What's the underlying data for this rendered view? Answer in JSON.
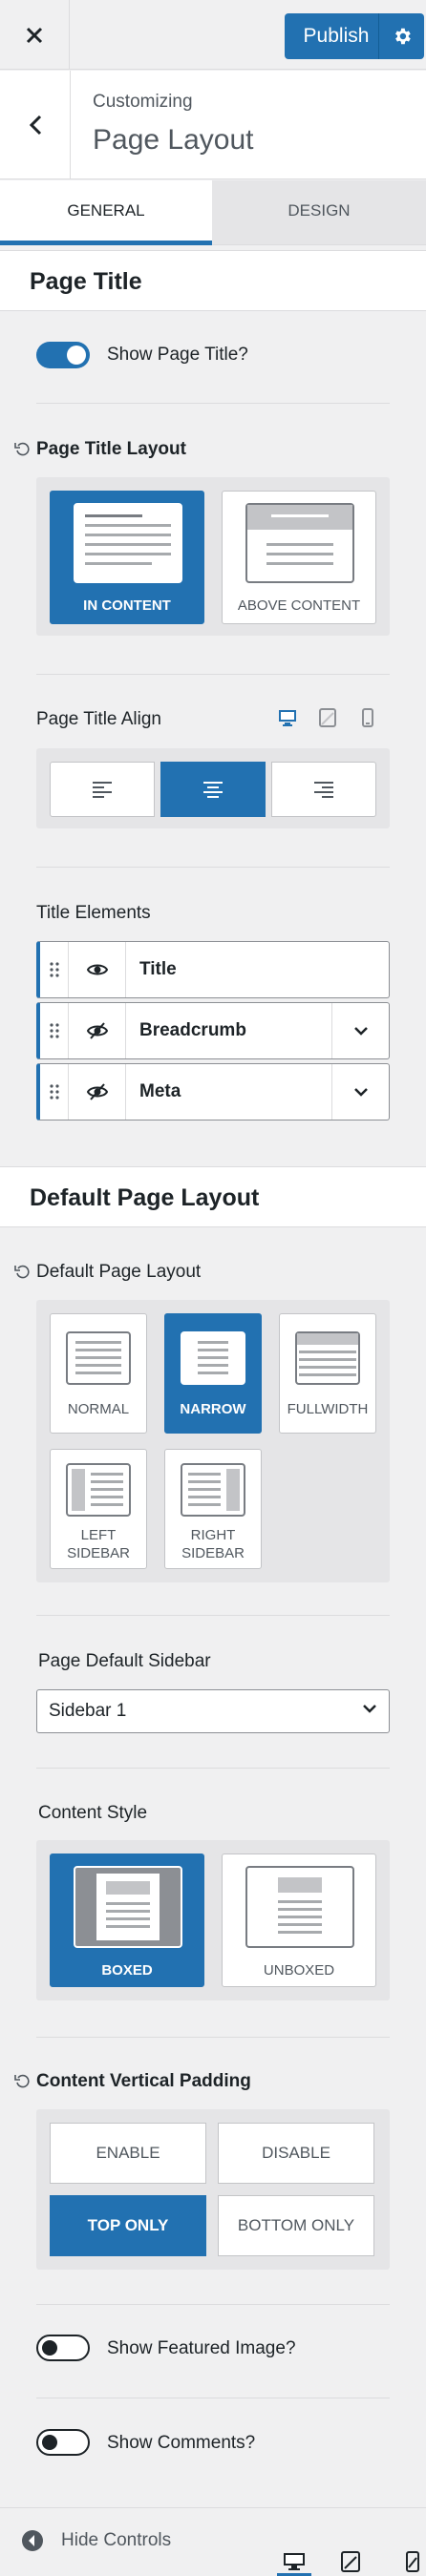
{
  "topbar": {
    "close_icon": "close-icon",
    "publish_label": "Publish",
    "settings_icon": "gear-icon"
  },
  "header": {
    "subtitle": "Customizing",
    "title": "Page Layout"
  },
  "tabs": [
    {
      "label": "General",
      "active": true
    },
    {
      "label": "Design",
      "active": false
    }
  ],
  "page_title_section": {
    "heading": "Page Title",
    "show_page_title": {
      "label": "Show Page Title?",
      "enabled": true
    },
    "layout": {
      "label": "Page Title Layout",
      "options": [
        {
          "label": "IN CONTENT",
          "selected": true
        },
        {
          "label": "ABOVE CONTENT",
          "selected": false
        }
      ]
    },
    "align": {
      "label": "Page Title Align",
      "devices": [
        "desktop-icon",
        "tablet-icon",
        "mobile-icon"
      ],
      "options": [
        "align-left-icon",
        "align-center-icon",
        "align-right-icon"
      ],
      "selected_index": 1
    },
    "elements": {
      "label": "Title Elements",
      "items": [
        {
          "name": "Title",
          "visible": true,
          "expandable": false
        },
        {
          "name": "Breadcrumb",
          "visible": false,
          "expandable": true
        },
        {
          "name": "Meta",
          "visible": false,
          "expandable": true
        }
      ]
    }
  },
  "default_layout_section": {
    "heading": "Default Page Layout",
    "layout": {
      "label": "Default Page Layout",
      "options": [
        {
          "label": "NORMAL",
          "selected": false
        },
        {
          "label": "NARROW",
          "selected": true
        },
        {
          "label": "FULLWIDTH",
          "selected": false
        },
        {
          "label": "LEFT SIDEBAR",
          "selected": false
        },
        {
          "label": "RIGHT SIDEBAR",
          "selected": false
        }
      ]
    },
    "sidebar": {
      "label": "Page Default Sidebar",
      "value": "Sidebar 1"
    },
    "content_style": {
      "label": "Content Style",
      "options": [
        {
          "label": "BOXED",
          "selected": true
        },
        {
          "label": "UNBOXED",
          "selected": false
        }
      ]
    },
    "vertical_padding": {
      "label": "Content Vertical Padding",
      "options": [
        {
          "label": "ENABLE",
          "selected": false
        },
        {
          "label": "DISABLE",
          "selected": false
        },
        {
          "label": "TOP ONLY",
          "selected": true
        },
        {
          "label": "BOTTOM ONLY",
          "selected": false
        }
      ]
    },
    "show_featured_image": {
      "label": "Show Featured Image?",
      "enabled": false
    },
    "show_comments": {
      "label": "Show Comments?",
      "enabled": false
    }
  },
  "footer": {
    "hide_controls_label": "Hide Controls",
    "devices": [
      "desktop-icon",
      "tablet-icon",
      "mobile-icon"
    ],
    "active_device": "desktop"
  },
  "colors": {
    "accent": "#2271b1",
    "panel": "#e5e5e7",
    "background": "#f0f0f1"
  }
}
